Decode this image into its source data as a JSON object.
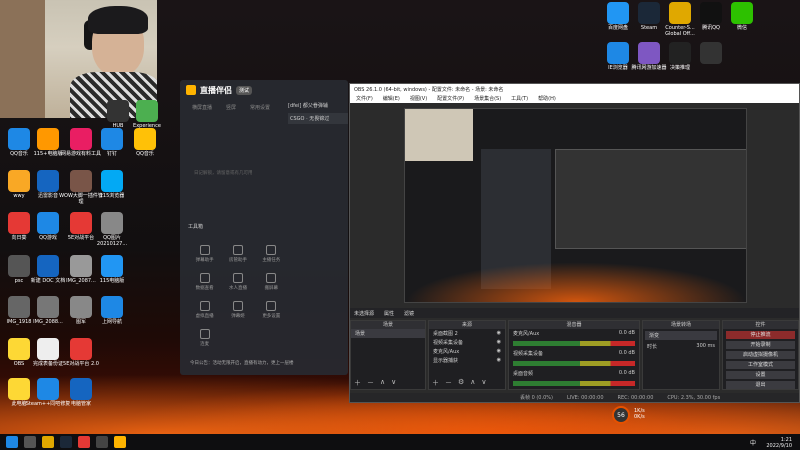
{
  "webcam": {
    "label": "webcam"
  },
  "desktop_icons_right": [
    {
      "label": "百度网盘",
      "icon": "cloud-icon",
      "color": "#2196f3"
    },
    {
      "label": "Steam",
      "icon": "steam-icon",
      "color": "#1b2838"
    },
    {
      "label": "Counter-S... Global Off...",
      "icon": "game-icon",
      "color": "#e0a800"
    },
    {
      "label": "腾讯QQ",
      "icon": "qq-icon",
      "color": "#111111"
    },
    {
      "label": "微信",
      "icon": "wechat-icon",
      "color": "#2dc100"
    },
    {
      "label": "IE浏览器",
      "icon": "edge-icon",
      "color": "#1e88e5"
    },
    {
      "label": "腾讯网游加速器",
      "icon": "accelerator-icon",
      "color": "#7e57c2"
    },
    {
      "label": "决策推理",
      "icon": "mw-icon",
      "color": "#222222"
    },
    {
      "label": "",
      "icon": "app-icon",
      "color": "#333333"
    }
  ],
  "desktop_icons_left": [
    {
      "label": "HUB",
      "icon": "hub-icon",
      "color": "#333333"
    },
    {
      "label": "Experience",
      "icon": "experience-icon",
      "color": "#4caf50"
    },
    {
      "label": "QQ音乐",
      "icon": "music-icon",
      "color": "#1e88e5"
    },
    {
      "label": "115+电脑版",
      "icon": "cloud-icon",
      "color": "#ff9800"
    },
    {
      "label": "网易游戏有料工具",
      "icon": "tool-icon",
      "color": "#e91e63"
    },
    {
      "label": "钉钉",
      "icon": "dingtalk-icon",
      "color": "#1e88e5"
    },
    {
      "label": "QQ音乐",
      "icon": "qq-icon",
      "color": "#ffc107"
    },
    {
      "label": "wwy",
      "icon": "folder-icon",
      "color": "#f9a825"
    },
    {
      "label": "迅雷影音",
      "icon": "play-icon",
      "color": "#1565c0"
    },
    {
      "label": "WOW大脚一插件管理",
      "icon": "wow-icon",
      "color": "#795548"
    },
    {
      "label": "115浏览器",
      "icon": "browser-icon",
      "color": "#03a9f4"
    },
    {
      "label": "向日葵",
      "icon": "sunflower-icon",
      "color": "#e53935"
    },
    {
      "label": "QQ游戏",
      "icon": "qqgame-icon",
      "color": "#1e88e5"
    },
    {
      "label": "5E对战平台",
      "icon": "5e-icon",
      "color": "#e53935"
    },
    {
      "label": "QQ图片20210127...",
      "icon": "image-icon",
      "color": "#888888"
    },
    {
      "label": "psc",
      "icon": "folder-icon",
      "color": "#555555"
    },
    {
      "label": "新建 DOC 文档",
      "icon": "doc-icon",
      "color": "#1565c0"
    },
    {
      "label": "IMG_2087...",
      "icon": "image-icon",
      "color": "#999999"
    },
    {
      "label": "115电脑版",
      "icon": "cloud-icon",
      "color": "#2196f3"
    },
    {
      "label": "IMG_1918",
      "icon": "image-icon",
      "color": "#666666"
    },
    {
      "label": "IMG_2088...",
      "icon": "image-icon",
      "color": "#777777"
    },
    {
      "label": "图军",
      "icon": "image-icon",
      "color": "#888888"
    },
    {
      "label": "上网导航",
      "icon": "ie-icon",
      "color": "#1e88e5"
    },
    {
      "label": "OBS",
      "icon": "doc-icon",
      "color": "#fdd835"
    },
    {
      "label": "完成表备份证",
      "icon": "doc-icon",
      "color": "#eeeeee"
    },
    {
      "label": "5E对战平台 2.0",
      "icon": "5e-icon",
      "color": "#e53935"
    },
    {
      "label": "此电脑",
      "icon": "pc-icon",
      "color": "#fdd835"
    },
    {
      "label": "Steam++同吧修复",
      "icon": "doc-icon",
      "color": "#1e88e5"
    },
    {
      "label": "电脑管家",
      "icon": "shield-icon",
      "color": "#1565c0"
    }
  ],
  "zhibo": {
    "title": "直播伴侣",
    "badge": "测试",
    "tabs": [
      "横屏直播",
      "竖屏",
      "常用设置"
    ],
    "side_title": "[dfei] 都父眷弹辅",
    "side_sub": "CSGO · 无畏锦过",
    "hint": "日记解锁，请留意或有几可用",
    "tools_label": "工具箱",
    "tools": [
      "弹幕助手",
      "房管助手",
      "主播任务",
      "数据查看",
      "水人直播",
      "搬屏幕",
      "虚拟直播",
      "弹幕姬",
      "更多设置",
      "连麦"
    ],
    "footer": "今日公告：活动无限开启，直播有动力，更上一层楼"
  },
  "obs": {
    "title": "OBS 26.1.0 (64-bit, windows) - 配置文件: 未命名 - 场景: 未命名",
    "menu": [
      "文件(F)",
      "编辑(E)",
      "视图(V)",
      "配置文件(P)",
      "场景集合(S)",
      "工具(T)",
      "帮助(H)"
    ],
    "panels": {
      "scenes_title": "场景",
      "scenes": [
        "场景"
      ],
      "sources_title": "来源",
      "sources": [
        "桌面截图 2",
        "视频采集设备",
        "麦克风/Aux",
        "显示器捕获"
      ],
      "mixer_title": "混音器",
      "mixer": [
        {
          "name": "麦克风/Aux",
          "db": "0.0 dB"
        },
        {
          "name": "视频采集设备",
          "db": "0.0 dB"
        },
        {
          "name": "桌面音频",
          "db": "0.0 dB"
        }
      ],
      "transitions_title": "场景转场",
      "transition_value": "渐变",
      "duration_label": "时长",
      "duration_value": "300 ms",
      "controls_title": "控件",
      "controls": [
        "停止推流",
        "开始录制",
        "启动虚拟摄像机",
        "工作室模式",
        "设置",
        "退出"
      ]
    },
    "no_source": "未选择源",
    "properties": "属性",
    "filters": "滤镜",
    "status": [
      "丢帧 0 (0.0%)",
      "LIVE: 00:00:00",
      "REC: 00:00:00",
      "CPU: 2.3%, 30.00 fps"
    ]
  },
  "taskbar": {
    "time": "1:21",
    "date": "2022/9/10",
    "lang": "中"
  },
  "overlay": {
    "fps_badge": "56",
    "net_up": "1K/s",
    "net_down": "0K/s"
  }
}
